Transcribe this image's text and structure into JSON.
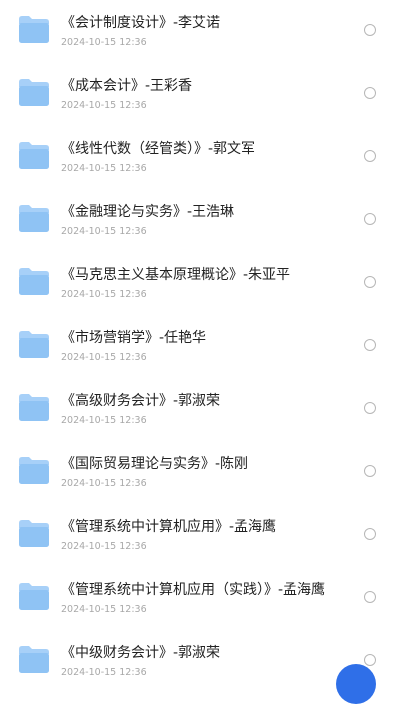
{
  "files": [
    {
      "name": "《会计制度设计》-李艾诺",
      "date": "2024-10-15 12:36",
      "icon": "folder-icon"
    },
    {
      "name": "《成本会计》-王彩香",
      "date": "2024-10-15 12:36",
      "icon": "folder-icon"
    },
    {
      "name": "《线性代数（经管类）》-郭文军",
      "date": "2024-10-15 12:36",
      "icon": "folder-icon"
    },
    {
      "name": "《金融理论与实务》-王浩琳",
      "date": "2024-10-15 12:36",
      "icon": "folder-icon"
    },
    {
      "name": "《马克思主义基本原理概论》-朱亚平",
      "date": "2024-10-15 12:36",
      "icon": "folder-icon"
    },
    {
      "name": "《市场营销学》-任艳华",
      "date": "2024-10-15 12:36",
      "icon": "folder-icon"
    },
    {
      "name": "《高级财务会计》-郭淑荣",
      "date": "2024-10-15 12:36",
      "icon": "folder-icon"
    },
    {
      "name": "《国际贸易理论与实务》-陈刚",
      "date": "2024-10-15 12:36",
      "icon": "folder-icon"
    },
    {
      "name": "《管理系统中计算机应用》-孟海鹰",
      "date": "2024-10-15 12:36",
      "icon": "folder-icon"
    },
    {
      "name": "《管理系统中计算机应用（实践）》-孟海鹰",
      "date": "2024-10-15 12:36",
      "icon": "folder-icon"
    },
    {
      "name": "《中级财务会计》-郭淑荣",
      "date": "2024-10-15 12:36",
      "icon": "folder-icon"
    }
  ],
  "colors": {
    "folder_body": "#8fc3f4",
    "folder_tab": "#a7d0f8",
    "title_text": "#222222",
    "date_text": "#a8a8a8",
    "radio_border": "#b7b7b7",
    "fab": "#2f6fe8"
  },
  "icons": {
    "select": "radio-circle-icon",
    "floating_action": "floating-action-button"
  }
}
